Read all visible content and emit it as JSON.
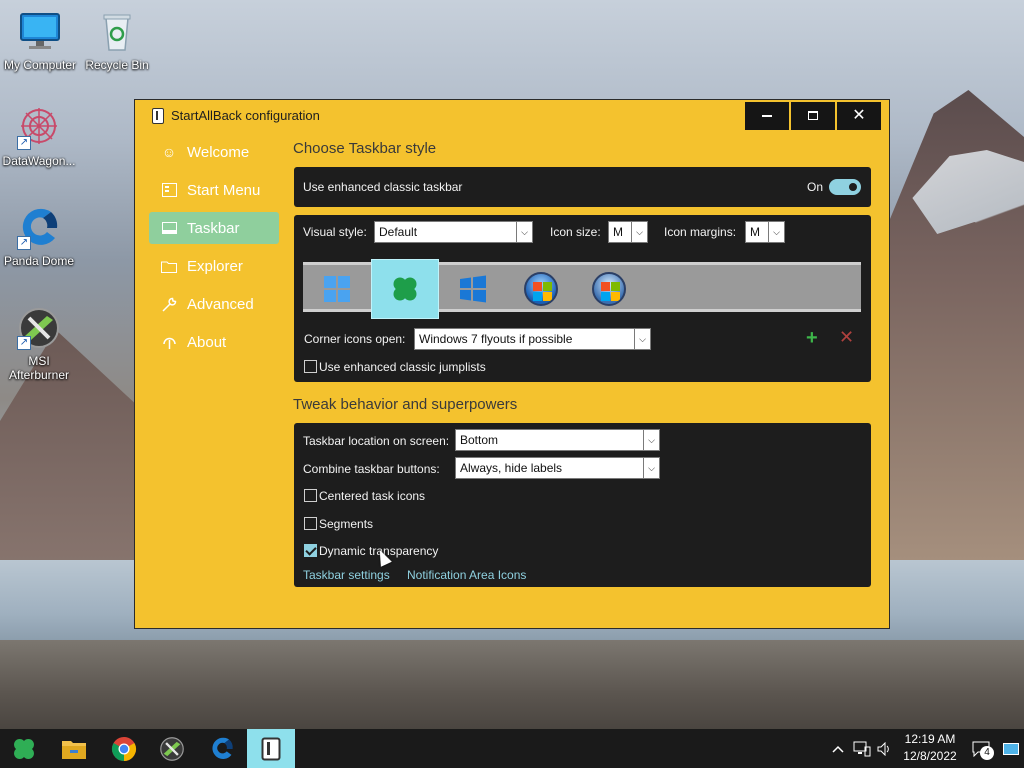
{
  "desktop": {
    "icons": [
      {
        "label": "My Computer"
      },
      {
        "label": "Recycle Bin"
      },
      {
        "label": "DataWagon..."
      },
      {
        "label": "Panda Dome"
      },
      {
        "label": "MSI Afterburner"
      }
    ]
  },
  "window": {
    "title": "StartAllBack configuration",
    "minimize_label": "Minimize",
    "maximize_label": "Maximize",
    "close_label": "Close"
  },
  "sidebar": {
    "items": [
      {
        "label": "Welcome",
        "icon": "smile-icon"
      },
      {
        "label": "Start Menu",
        "icon": "start-menu-icon"
      },
      {
        "label": "Taskbar",
        "icon": "taskbar-icon"
      },
      {
        "label": "Explorer",
        "icon": "folder-icon"
      },
      {
        "label": "Advanced",
        "icon": "wrench-icon"
      },
      {
        "label": "About",
        "icon": "info-icon"
      }
    ],
    "active_index": 2
  },
  "style_section": {
    "title": "Choose Taskbar style",
    "enhanced_label": "Use enhanced classic taskbar",
    "toggle_label": "On",
    "visual_style_label": "Visual style:",
    "visual_style_value": "Default",
    "icon_size_label": "Icon size:",
    "icon_size_value": "M",
    "icon_margins_label": "Icon margins:",
    "icon_margins_value": "M",
    "styles": [
      "Windows 11",
      "StartAllBack",
      "Windows 10",
      "Windows 7",
      "Windows Vista"
    ],
    "selected_style_index": 1,
    "corner_label": "Corner icons open:",
    "corner_value": "Windows 7 flyouts if possible",
    "jumplists_label": "Use enhanced classic jumplists"
  },
  "tweak_section": {
    "title": "Tweak behavior and superpowers",
    "location_label": "Taskbar location on screen:",
    "location_value": "Bottom",
    "combine_label": "Combine taskbar buttons:",
    "combine_value": "Always, hide labels",
    "centered_label": "Centered task icons",
    "segments_label": "Segments",
    "transparency_label": "Dynamic transparency",
    "settings_link": "Taskbar settings",
    "notif_link": "Notification Area Icons"
  },
  "taskbar": {
    "time": "12:19 AM",
    "date": "12/8/2022",
    "notification_count": "4"
  },
  "colors": {
    "window_bg": "#f4c22e",
    "panel_bg": "#1d1d1d",
    "accent": "#8fd1e0",
    "active_nav": "#8fcf9d"
  }
}
